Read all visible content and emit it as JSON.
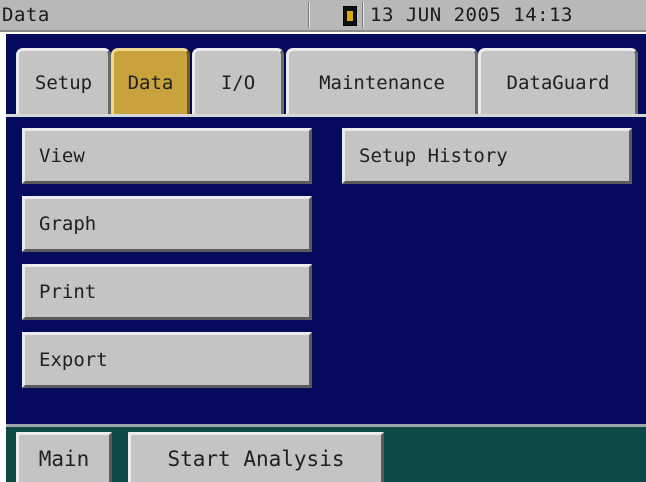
{
  "status_bar": {
    "title": "Data",
    "datetime": "13 JUN 2005 14:13",
    "indicator_icon": "status-indicator-icon"
  },
  "tabs": [
    {
      "label": "Setup",
      "active": false
    },
    {
      "label": "Data",
      "active": true
    },
    {
      "label": "I/O",
      "active": false
    },
    {
      "label": "Maintenance",
      "active": false
    },
    {
      "label": "DataGuard",
      "active": false
    }
  ],
  "main": {
    "left_buttons": [
      {
        "label": "View"
      },
      {
        "label": "Graph"
      },
      {
        "label": "Print"
      },
      {
        "label": "Export"
      }
    ],
    "right_buttons": [
      {
        "label": "Setup History"
      }
    ]
  },
  "bottom_bar": {
    "main_label": "Main",
    "start_analysis_label": "Start Analysis"
  },
  "colors": {
    "main_background": "#050a5c",
    "active_tab": "#c8a23c",
    "button_face": "#c4c4c4",
    "bottom_bar": "#0d4a46",
    "status_bar": "#b8b8b8"
  }
}
